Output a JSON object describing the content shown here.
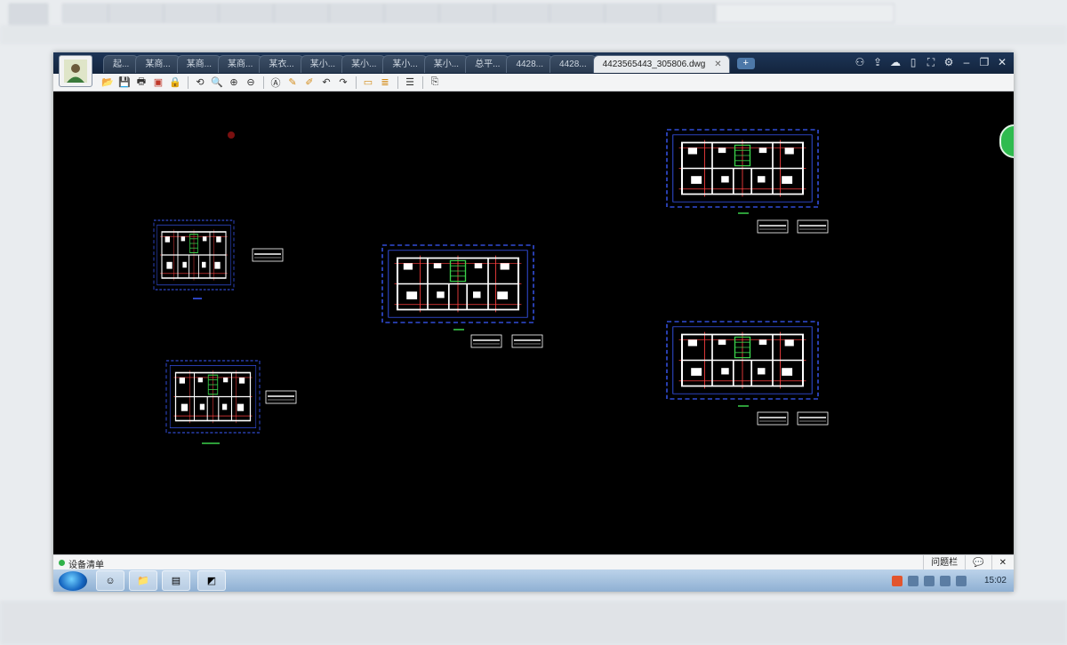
{
  "tabs": [
    "起...",
    "某商...",
    "某商...",
    "某商...",
    "某衣...",
    "某小...",
    "某小...",
    "某小...",
    "某小...",
    "总平...",
    "4428...",
    "4428...",
    "4423565443_305806.dwg"
  ],
  "add_tab_label": "+",
  "status": {
    "left_label": "设备清单",
    "right_label": "问题栏"
  },
  "taskbar": {
    "clock": "15:02"
  },
  "colors": {
    "canvas": "#000000",
    "wall": "#ffffff",
    "dim_line": "#3b5bff",
    "axis": "#ff4040",
    "stair": "#3ad14a"
  }
}
